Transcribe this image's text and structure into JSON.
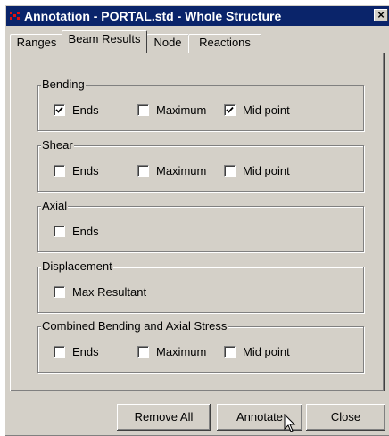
{
  "window": {
    "title": "Annotation - PORTAL.std - Whole Structure",
    "close_glyph": "×",
    "icon": "app-icon"
  },
  "tabs": [
    {
      "label": "Ranges",
      "active": false
    },
    {
      "label": "Beam Results",
      "active": true
    },
    {
      "label": "Node",
      "active": false
    },
    {
      "label": "Reactions",
      "active": false
    }
  ],
  "groups": {
    "bending": {
      "title": "Bending",
      "ends": true,
      "maximum": false,
      "mid_point": true
    },
    "shear": {
      "title": "Shear",
      "ends": false,
      "maximum": false,
      "mid_point": false
    },
    "axial": {
      "title": "Axial",
      "ends": false
    },
    "displacement": {
      "title": "Displacement",
      "max_resultant": false
    },
    "combined": {
      "title": "Combined Bending and Axial Stress",
      "ends": false,
      "maximum": false,
      "mid_point": false
    }
  },
  "labels": {
    "ends": "Ends",
    "maximum": "Maximum",
    "mid_point": "Mid point",
    "max_resultant": "Max Resultant"
  },
  "buttons": {
    "remove_all": "Remove All",
    "annotate": "Annotate",
    "close": "Close"
  }
}
